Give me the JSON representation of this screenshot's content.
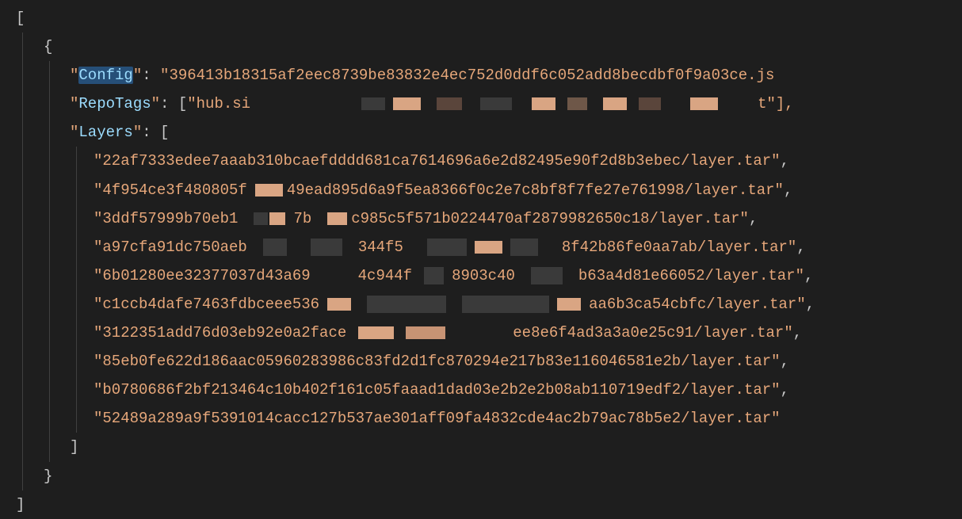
{
  "json_display": {
    "open_bracket": "[",
    "open_brace": "{",
    "keys": {
      "config": "Config",
      "repotags": "RepoTags",
      "layers": "Layers"
    },
    "config_value": "396413b18315af2eec8739be83832e4ec752d0ddf6c052add8becdbf0f9a03ce.js",
    "repotags_prefix": "hub.si",
    "repotags_suffix": "t\"],",
    "layers_open": "[",
    "layers": [
      {
        "text": "22af7333edee7aaab310bcaefdddd681ca7614696a6e2d82495e90f2d8b3ebec/layer.tar",
        "trail": ","
      },
      {
        "left": "4f954ce3f480805f",
        "right": "49ead895d6a9f5ea8366f0c2e7c8bf8f7fe27e761998/layer.tar",
        "trail": ",",
        "redact_a": true
      },
      {
        "left": "3ddf57999b70eb1",
        "mid": "7b",
        "right": "c985c5f571b0224470af2879982650c18/layer.tar",
        "trail": ",",
        "redact_b": true
      },
      {
        "left": "a97cfa91dc750aeb",
        "mid": "344f5",
        "right": "8f42b86fe0aa7ab/layer.tar",
        "trail": ",",
        "redact_c": true
      },
      {
        "left": "6b01280ee32377037d43a69",
        "mid": "4c944f",
        "mid2": "8903c40",
        "right": "b63a4d81e66052/layer.tar",
        "trail": ",",
        "redact_d": true
      },
      {
        "left": "c1ccb4dafe7463fdbceee536",
        "right": "aa6b3ca54cbfc/layer.tar",
        "trail": ",",
        "redact_e": true
      },
      {
        "left": "3122351add76d03eb92e0a2face",
        "right": "ee8e6f4ad3a3a0e25c91/layer.tar",
        "trail": ",",
        "redact_f": true
      },
      {
        "text": "85eb0fe622d186aac05960283986c83fd2d1fc870294e217b83e116046581e2b/layer.tar",
        "trail": ","
      },
      {
        "text": "b0780686f2bf213464c10b402f161c05faaad1dad03e2b2e2b08ab110719edf2/layer.tar",
        "trail": ","
      },
      {
        "text": "52489a289a9f5391014cacc127b537ae301aff09fa4832cde4ac2b79ac78b5e2/layer.tar",
        "trail": ""
      }
    ],
    "layers_close": "]",
    "close_brace": "}",
    "close_bracket": "]"
  }
}
